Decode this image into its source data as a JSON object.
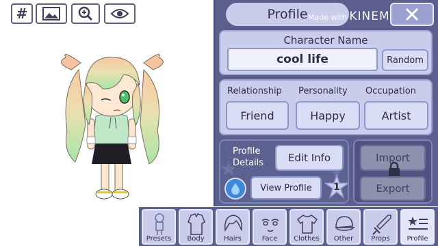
{
  "toolbar": {
    "grid_label": "#",
    "icons": [
      "image-icon",
      "zoom-in-icon",
      "eye-icon"
    ]
  },
  "panel": {
    "title": "Profile",
    "watermark_prefix": "Made with",
    "watermark_brand": "KINEMASTER",
    "close_icon": "close-icon",
    "character_name": {
      "label": "Character Name",
      "value": "cool life",
      "random_label": "Random"
    },
    "traits": {
      "relationship_label": "Relationship",
      "personality_label": "Personality",
      "occupation_label": "Occupation",
      "relationship_value": "Friend",
      "personality_value": "Happy",
      "occupation_value": "Artist"
    },
    "details": {
      "label_line1": "Profile",
      "label_line2": "Details",
      "edit_info_label": "Edit Info",
      "view_profile_label": "View Profile",
      "star_count": "1"
    },
    "import_label": "Import",
    "export_label": "Export"
  },
  "tabs": [
    {
      "label": "Presets",
      "icon": "presets-icon"
    },
    {
      "label": "Body",
      "icon": "body-icon"
    },
    {
      "label": "Hairs",
      "icon": "hair-icon"
    },
    {
      "label": "Face",
      "icon": "face-icon"
    },
    {
      "label": "Clothes",
      "icon": "shirt-icon"
    },
    {
      "label": "Other",
      "icon": "cap-icon"
    },
    {
      "label": "Props",
      "icon": "sword-icon"
    },
    {
      "label": "Profile",
      "icon": "profile-list-icon"
    }
  ],
  "colors": {
    "panel_bg": "#5a5f8e",
    "card_bg": "#c9cdeb",
    "button_bg": "#d8dcf5",
    "text": "#2d2f46"
  }
}
